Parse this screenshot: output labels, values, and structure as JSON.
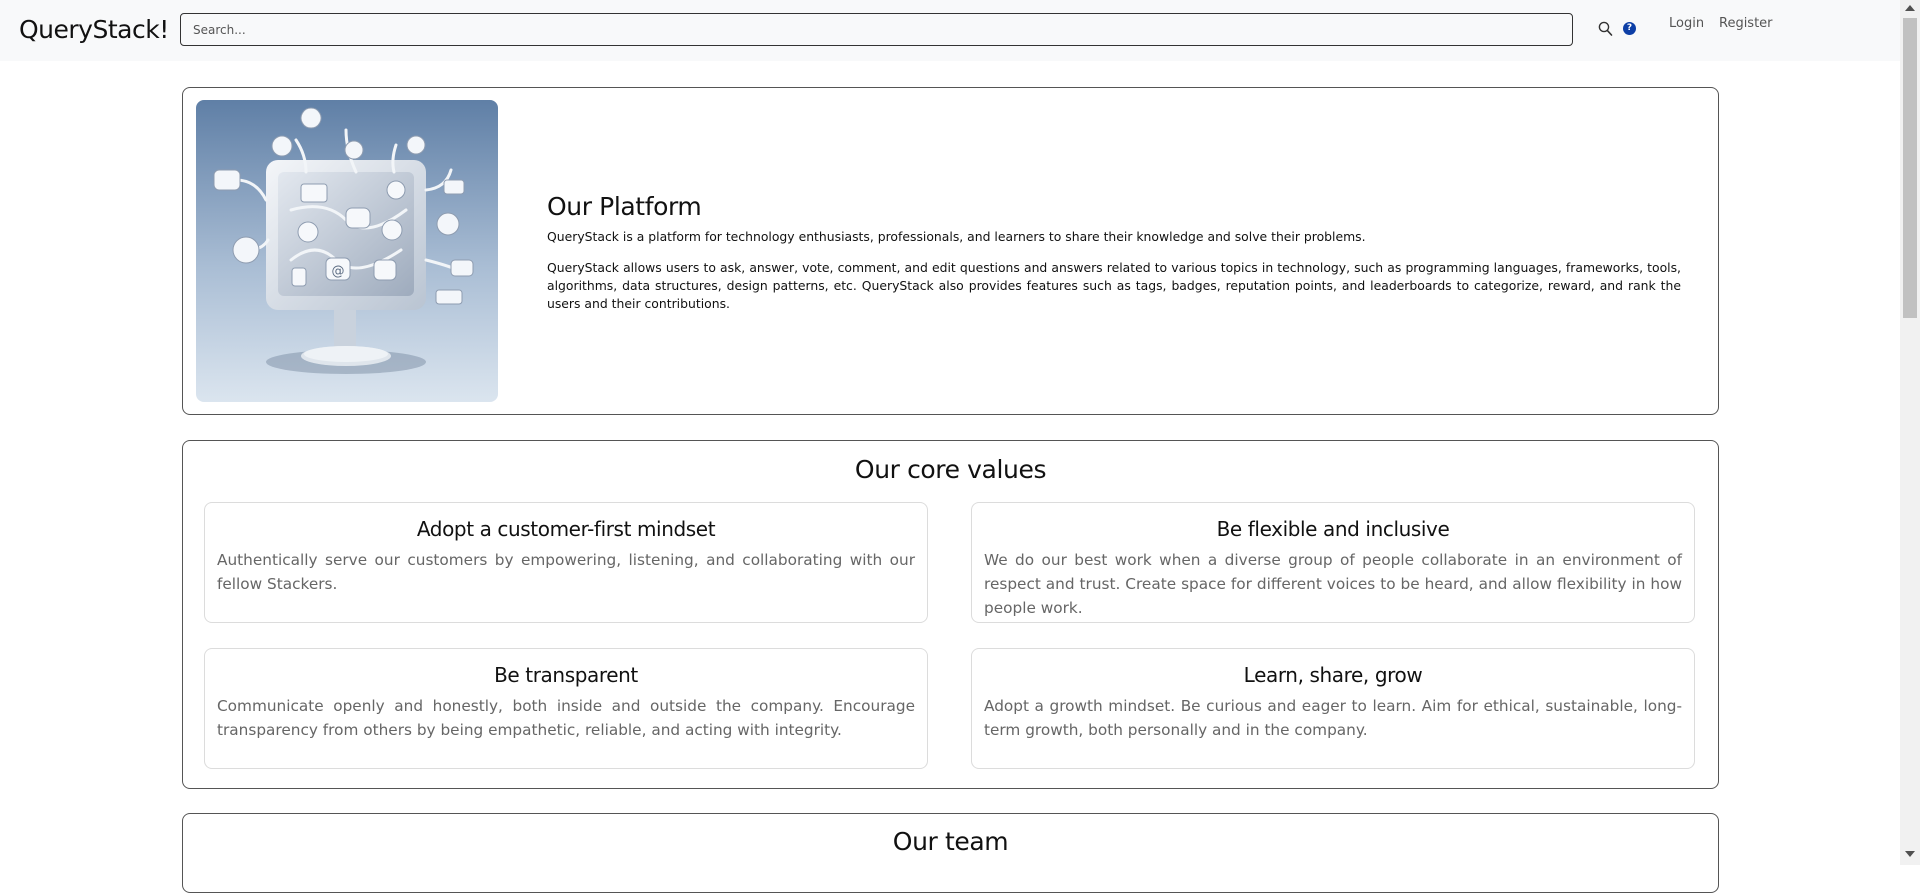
{
  "header": {
    "brand": "QueryStack!",
    "search_placeholder": "Search...",
    "help_label": "?",
    "login": "Login",
    "register": "Register"
  },
  "platform": {
    "title": "Our Platform",
    "paragraphs": [
      "QueryStack is a platform for technology enthusiasts, professionals, and learners to share their knowledge and solve their problems.",
      "QueryStack allows users to ask, answer, vote, comment, and edit questions and answers related to various topics in technology, such as programming languages, frameworks, tools, algorithms, data structures, design patterns, etc. QueryStack also provides features such as tags, badges, reputation points, and leaderboards to categorize, reward, and rank the users and their contributions."
    ]
  },
  "values": {
    "title": "Our core values",
    "items": [
      {
        "title": "Adopt a customer-first mindset",
        "description": "Authentically serve our customers by empowering, listening, and collaborating with our fellow Stackers."
      },
      {
        "title": "Be flexible and inclusive",
        "description": "We do our best work when a diverse group of people collaborate in an environment of respect and trust. Create space for different voices to be heard, and allow flexibility in how people work."
      },
      {
        "title": "Be transparent",
        "description": "Communicate openly and honestly, both inside and outside the company. Encourage transparency from others by being empathetic, reliable, and acting with integrity."
      },
      {
        "title": "Learn, share, grow",
        "description": "Adopt a growth mindset. Be curious and eager to learn. Aim for ethical, sustainable, long-term growth, both personally and in the company."
      }
    ]
  },
  "team": {
    "title": "Our team"
  },
  "icons": {
    "search": "search-icon",
    "help": "help-icon",
    "scroll_up": "chevron-up-icon",
    "scroll_down": "chevron-down-icon"
  },
  "colors": {
    "navbar_bg": "#f8f9fa",
    "help_icon": "#0d3fa6",
    "card_border": "#555555",
    "muted_text": "#666666"
  }
}
